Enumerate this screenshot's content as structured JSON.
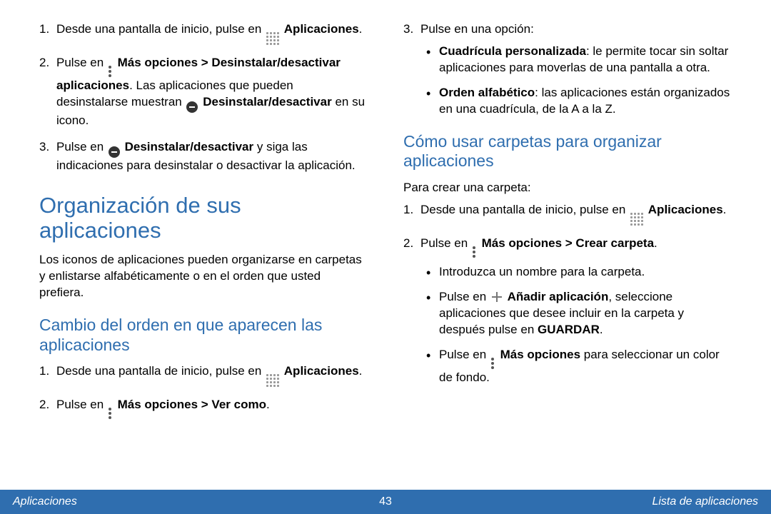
{
  "col_left": {
    "steps_a": [
      {
        "num": "1.",
        "pre": "Desde una pantalla de inicio, pulse en ",
        "icon": "apps",
        "post_bold": "Aplicaciones",
        "post": "."
      },
      {
        "num": "2.",
        "pre": "Pulse en ",
        "icon": "more",
        "bold1": "Más opciones > Desinstalar/desactivar aplicaciones",
        "mid": ". Las aplicaciones que pueden desinstalarse muestran ",
        "icon2": "minus",
        "bold2": "Desinstalar/desactivar",
        "post": " en su icono."
      },
      {
        "num": "3.",
        "pre": "Pulse en ",
        "icon": "minus",
        "bold1": "Desinstalar/desactivar",
        "post": " y siga las indicaciones para desinstalar o desactivar la aplicación."
      }
    ],
    "h1": "Organización de sus aplicaciones",
    "para1": "Los iconos de aplicaciones pueden organizarse en carpetas y enlistarse alfabéticamente o en el orden que usted prefiera.",
    "h2": "Cambio del orden en que aparecen las aplicaciones",
    "steps_b": [
      {
        "num": "1.",
        "pre": "Desde una pantalla de inicio, pulse en ",
        "icon": "apps",
        "post_bold": "Aplicaciones",
        "post": "."
      },
      {
        "num": "2.",
        "pre": "Pulse en ",
        "icon": "more",
        "bold1": "Más opciones > Ver como",
        "post": "."
      }
    ]
  },
  "col_right": {
    "step3_num": "3.",
    "step3_text": "Pulse en una opción:",
    "step3_bullets": [
      {
        "bold": "Cuadrícula personalizada",
        "text": ": le permite tocar sin soltar aplicaciones para moverlas de una pantalla a otra."
      },
      {
        "bold": "Orden alfabético",
        "text": ": las aplicaciones están organizados en una cuadrícula, de la A a la Z."
      }
    ],
    "h2": "Cómo usar carpetas para organizar aplicaciones",
    "para_intro": "Para crear una carpeta:",
    "steps": [
      {
        "num": "1.",
        "pre": "Desde una pantalla de inicio, pulse en ",
        "icon": "apps",
        "post_bold": "Aplicaciones",
        "post": "."
      },
      {
        "num": "2.",
        "pre": "Pulse en ",
        "icon": "more",
        "bold1": "Más opciones > Crear carpeta",
        "post": "."
      }
    ],
    "step2_bullets": [
      {
        "text": "Introduzca un nombre para la carpeta."
      },
      {
        "pre": "Pulse en ",
        "icon": "plus",
        "bold": "Añadir aplicación",
        "mid": ", seleccione aplicaciones que desee incluir en la carpeta y después pulse en ",
        "bold2": "GUARDAR",
        "post": "."
      },
      {
        "pre": "Pulse en ",
        "icon": "more",
        "bold": "Más opciones",
        "post": " para seleccionar un color de fondo."
      }
    ]
  },
  "footer": {
    "left": "Aplicaciones",
    "center": "43",
    "right": "Lista de aplicaciones"
  }
}
